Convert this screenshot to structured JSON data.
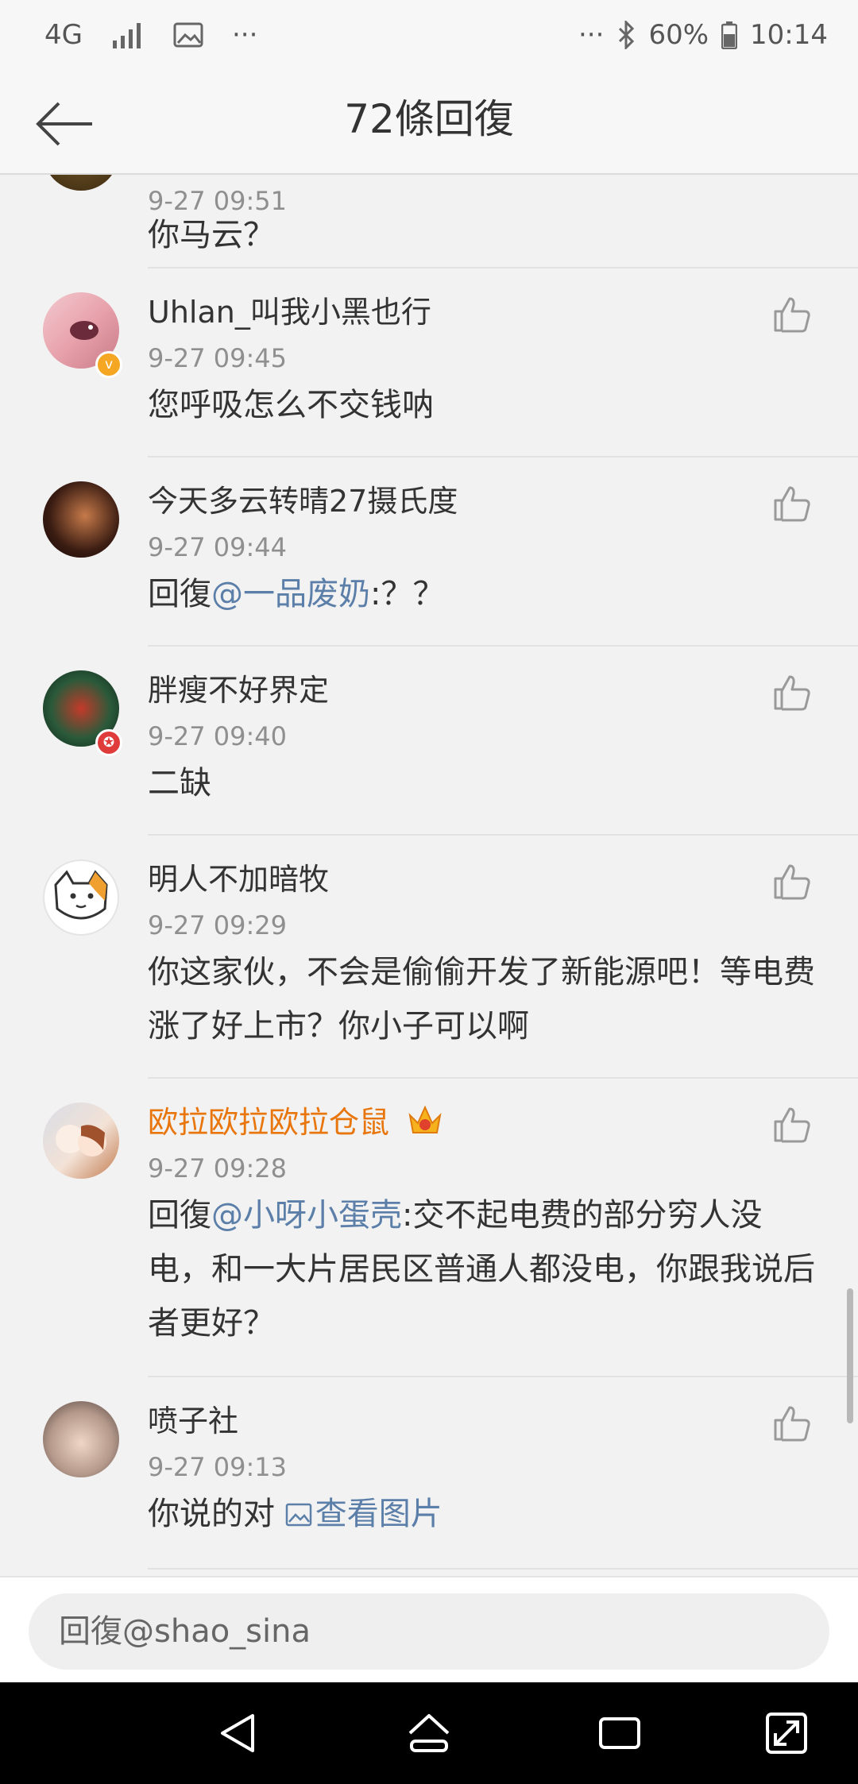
{
  "status_bar": {
    "network": "4G",
    "more": "···",
    "dots": "···",
    "battery": "60%",
    "time": "10:14"
  },
  "header": {
    "title": "72條回復"
  },
  "comments": [
    {
      "time": "9-27 09:51",
      "text": "你马云？"
    },
    {
      "name": "Uhlan_叫我小黑也行",
      "time": "9-27 09:45",
      "text": "您呼吸怎么不交钱呐",
      "badge": "v"
    },
    {
      "name": "今天多云转晴27摄氏度",
      "time": "9-27 09:44",
      "reply_prefix": "回復",
      "mention": "@一品废奶",
      "text": ":？？"
    },
    {
      "name": "胖瘦不好界定",
      "time": "9-27 09:40",
      "text": "二缺",
      "badge": "✪"
    },
    {
      "name": "明人不加暗牧",
      "time": "9-27 09:29",
      "text": "你这家伙，不会是偷偷开发了新能源吧！等电费涨了好上市？你小子可以啊"
    },
    {
      "name": "欧拉欧拉欧拉仓鼠",
      "time": "9-27 09:28",
      "reply_prefix": "回復",
      "mention": "@小呀小蛋壳",
      "text": ":交不起电费的部分穷人没电，和一大片居民区普通人都没电，你跟我说后者更好？"
    },
    {
      "name": "喷子社",
      "time": "9-27 09:13",
      "text": "你说的对 ",
      "link": "查看图片"
    }
  ],
  "input": {
    "placeholder": "回復@shao_sina"
  },
  "colors": {
    "accent_link": "#5b7fa8",
    "vip_name": "#e8760d",
    "background": "#f2f2f2"
  }
}
